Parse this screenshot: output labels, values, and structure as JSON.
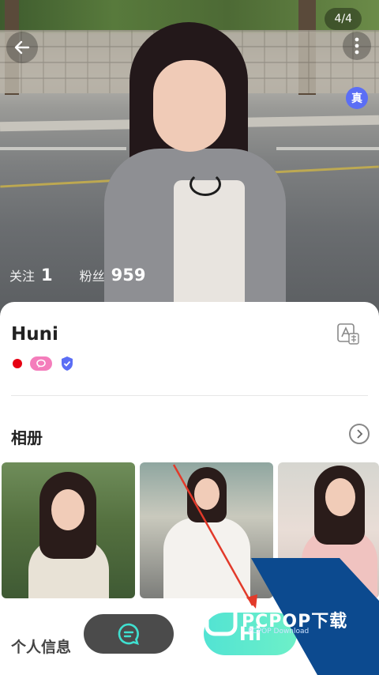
{
  "hero": {
    "counter": "4/4",
    "verify_badge": "真",
    "stats": [
      {
        "label": "关注",
        "value": "1"
      },
      {
        "label": "粉丝",
        "value": "959"
      }
    ]
  },
  "profile": {
    "name": "Huni",
    "translate_icon": "translate-icon",
    "badges": [
      "red-dot",
      "pink-chat-badge",
      "blue-shield-badge"
    ]
  },
  "album": {
    "title": "相册",
    "photo_count": 3
  },
  "info": {
    "title": "个人信息"
  },
  "actions": {
    "chat_icon": "chat-bubble-icon",
    "hi_label": "Hi"
  },
  "watermark": {
    "text": "PCPOP下载",
    "sub": "PCPOP Download"
  },
  "colors": {
    "accent_teal": "#52e3d3",
    "verify_blue": "#5b6ef5",
    "badge_pink": "#f47dbb",
    "dot_red": "#e60012",
    "watermark_blue": "#0c4a8f"
  }
}
